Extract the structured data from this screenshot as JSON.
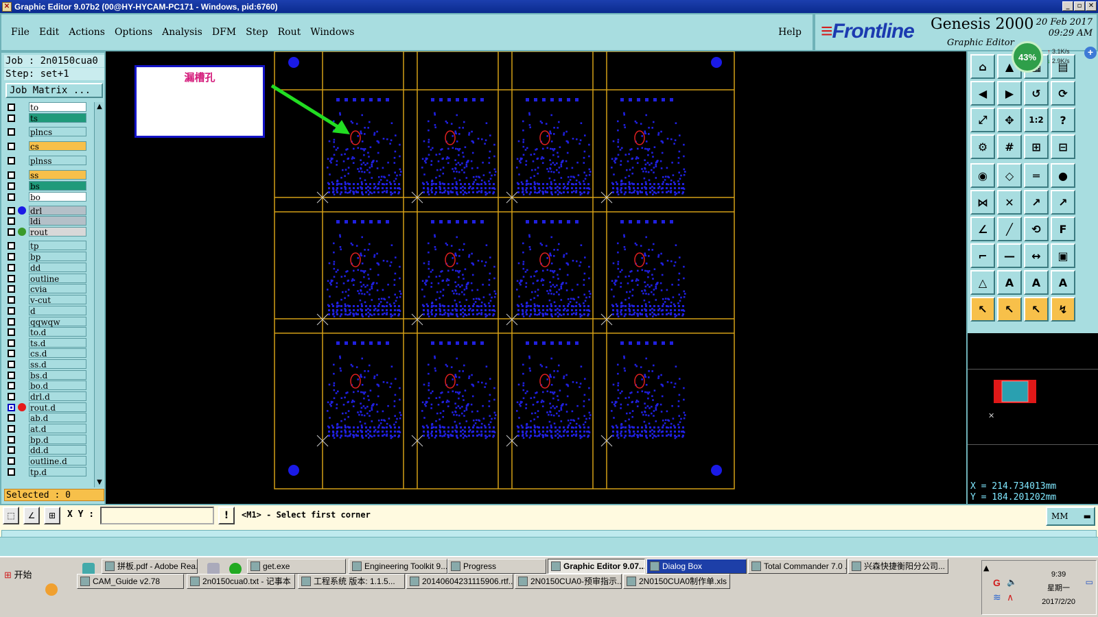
{
  "window": {
    "title": "Graphic Editor 9.07b2 (00@HY-HYCAM-PC171 - Windows, pid:6760)",
    "title_icon": "x-app-icon"
  },
  "menu": {
    "items": [
      "File",
      "Edit",
      "Actions",
      "Options",
      "Analysis",
      "DFM",
      "Step",
      "Rout",
      "Windows"
    ],
    "help": "Help"
  },
  "brand": {
    "logo": "Frontline",
    "product": "Genesis 2000",
    "subtitle": "Graphic Editor",
    "date": "20 Feb 2017",
    "time": "09:29 AM"
  },
  "netmeter": {
    "percent": "43%",
    "up": "3.1K/s",
    "down": "2.9K/s"
  },
  "job": {
    "job_line": "Job : 2n0150cua0",
    "step_line": "Step: set+1",
    "matrix_button": "Job Matrix ..."
  },
  "layers": [
    {
      "name": "to",
      "color": "#ffffff",
      "dot": null,
      "active": false
    },
    {
      "name": "ts",
      "color": "#1f9a7a",
      "dot": null,
      "active": false
    },
    {
      "name": "plncs",
      "color": "#a8dde0",
      "dot": null,
      "active": false
    },
    {
      "name": "cs",
      "color": "#f7c04a",
      "dot": null,
      "active": false
    },
    {
      "name": "plnss",
      "color": "#a8dde0",
      "dot": null,
      "active": false
    },
    {
      "name": "ss",
      "color": "#f7c04a",
      "dot": null,
      "active": false
    },
    {
      "name": "bs",
      "color": "#1f9a7a",
      "dot": null,
      "active": false
    },
    {
      "name": "bo",
      "color": "#ffffff",
      "dot": null,
      "active": false
    },
    {
      "name": "drl",
      "color": "#b4c0c8",
      "dot": "#1a1ae6",
      "active": false
    },
    {
      "name": "ldi",
      "color": "#b4c0c8",
      "dot": null,
      "active": false
    },
    {
      "name": "rout",
      "color": "#d8d8d8",
      "dot": "#3a9a2a",
      "active": false
    },
    {
      "name": "tp",
      "color": "#a8dde0",
      "dot": null,
      "active": false
    },
    {
      "name": "bp",
      "color": "#a8dde0",
      "dot": null,
      "active": false
    },
    {
      "name": "dd",
      "color": "#a8dde0",
      "dot": null,
      "active": false
    },
    {
      "name": "outline",
      "color": "#a8dde0",
      "dot": null,
      "active": false
    },
    {
      "name": "cvia",
      "color": "#a8dde0",
      "dot": null,
      "active": false
    },
    {
      "name": "v-cut",
      "color": "#a8dde0",
      "dot": null,
      "active": false
    },
    {
      "name": "d",
      "color": "#a8dde0",
      "dot": null,
      "active": false
    },
    {
      "name": "qqwqw",
      "color": "#a8dde0",
      "dot": null,
      "active": false
    },
    {
      "name": "to.d",
      "color": "#a8dde0",
      "dot": null,
      "active": false
    },
    {
      "name": "ts.d",
      "color": "#a8dde0",
      "dot": null,
      "active": false
    },
    {
      "name": "cs.d",
      "color": "#a8dde0",
      "dot": null,
      "active": false
    },
    {
      "name": "ss.d",
      "color": "#a8dde0",
      "dot": null,
      "active": false
    },
    {
      "name": "bs.d",
      "color": "#a8dde0",
      "dot": null,
      "active": false
    },
    {
      "name": "bo.d",
      "color": "#a8dde0",
      "dot": null,
      "active": false
    },
    {
      "name": "drl.d",
      "color": "#a8dde0",
      "dot": null,
      "active": false
    },
    {
      "name": "rout.d",
      "color": "#a8dde0",
      "dot": "#e61a1a",
      "active": true
    },
    {
      "name": "ab.d",
      "color": "#a8dde0",
      "dot": null,
      "active": false
    },
    {
      "name": "at.d",
      "color": "#a8dde0",
      "dot": null,
      "active": false
    },
    {
      "name": "bp.d",
      "color": "#a8dde0",
      "dot": null,
      "active": false
    },
    {
      "name": "dd.d",
      "color": "#a8dde0",
      "dot": null,
      "active": false
    },
    {
      "name": "outline.d",
      "color": "#a8dde0",
      "dot": null,
      "active": false
    },
    {
      "name": "tp.d",
      "color": "#a8dde0",
      "dot": null,
      "active": false
    }
  ],
  "selected": "Selected : 0",
  "annotation": {
    "text": "漏槽孔",
    "text_color": "#d4197a",
    "arrow_color": "#22dd22"
  },
  "canvas": {
    "panel_rows": 3,
    "panel_cols": 4,
    "colors": {
      "grid": "#d4a017",
      "pads": "#2020e0",
      "slot": "#e02020",
      "fiducial": "#1a1ae6",
      "marker": "#cccccc"
    }
  },
  "toolbar_icons": [
    "home-icon",
    "layer-up-icon",
    "panel-icon",
    "panel-alt-icon",
    "pan-left-icon",
    "pan-right-icon",
    "undo-icon",
    "redraw-icon",
    "zoom-fit-icon",
    "zoom-in-icon",
    "zoom-ratio-icon",
    "help-icon",
    "measure-tool-icon",
    "grid-icon",
    "net-icon",
    "net-alt-icon",
    "pad-icon",
    "shape-icon",
    "ruler-icon",
    "circle-icon",
    "connect-icon",
    "cross-icon",
    "line-pad-icon",
    "line-pad2-icon",
    "angle-icon",
    "line-icon",
    "arc-icon",
    "text-icon",
    "corner-icon",
    "minus-icon",
    "dimension-icon",
    "group-icon",
    "triangle-icon",
    "triangle-a-icon",
    "triangle-b-icon",
    "triangle-c-icon",
    "select-icon",
    "select-box-icon",
    "select-area-icon",
    "select-route-icon"
  ],
  "toolbar_glyphs": [
    "⌂",
    "▲",
    "▦",
    "▤",
    "◀",
    "▶",
    "↺",
    "⟳",
    "⤢",
    "✥",
    "1:2",
    "?",
    "⚙",
    "#",
    "⊞",
    "⊟",
    "◉",
    "◇",
    "═",
    "●",
    "⋈",
    "✕",
    "↗",
    "↗",
    "∠",
    "╱",
    "⟲",
    "F",
    "⌐",
    "—",
    "↔",
    "▣",
    "△",
    "A",
    "A",
    "A",
    "↖",
    "↖",
    "↖",
    "↯"
  ],
  "toolbar_yellow_start": 36,
  "coords": {
    "x": "X =  214.734013mm",
    "y": "Y =  184.201202mm"
  },
  "command": {
    "xy_label": "X Y :",
    "xy_value": "",
    "warn": "!",
    "prompt": "<M1> - Select first corner",
    "units": "MM"
  },
  "taskbar": {
    "start": "开始",
    "row1": [
      {
        "label": "拼板.pdf - Adobe Rea...",
        "active": false
      },
      {
        "label": "",
        "active": false
      },
      {
        "label": "get.exe",
        "active": false
      },
      {
        "label": "Engineering Toolkit 9....",
        "active": false
      },
      {
        "label": "Progress",
        "active": false
      },
      {
        "label": "Graphic Editor 9.07...",
        "active": true
      },
      {
        "label": "Dialog Box",
        "active": false,
        "blue": true
      },
      {
        "label": "Total Commander 7.0 ...",
        "active": false
      },
      {
        "label": "兴森快捷衡阳分公司...",
        "active": false
      }
    ],
    "row2": [
      {
        "label": "CAM_Guide v2.78"
      },
      {
        "label": "2n0150cua0.txt - 记事本"
      },
      {
        "label": "工程系统   版本: 1.1.5..."
      },
      {
        "label": "20140604231115906.rtf..."
      },
      {
        "label": "2N0150CUA0-预审指示..."
      },
      {
        "label": "2N0150CUA0制作单.xls ..."
      }
    ],
    "clock_time": "9:39",
    "clock_day": "星期一",
    "clock_date": "2017/2/20"
  }
}
